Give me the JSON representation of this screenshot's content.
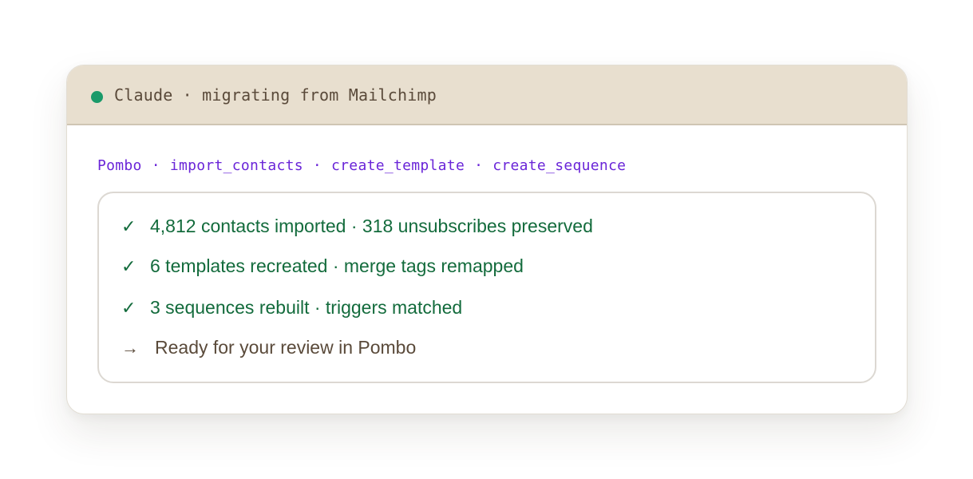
{
  "header": {
    "title": "Claude · migrating from Mailchimp",
    "status_color": "#1a9a6a"
  },
  "tools": [
    "Pombo",
    "import_contacts",
    "create_template",
    "create_sequence"
  ],
  "tool_separator": "·",
  "results": [
    {
      "icon": "check-icon",
      "text": "4,812 contacts imported · 318 unsubscribes preserved"
    },
    {
      "icon": "check-icon",
      "text": "6 templates recreated · merge tags remapped"
    },
    {
      "icon": "check-icon",
      "text": "3 sequences rebuilt · triggers matched"
    }
  ],
  "next_step": {
    "icon": "arrow-right-icon",
    "text": "Ready for your review in Pombo"
  },
  "colors": {
    "header_bg": "#e8dfcf",
    "tool_text": "#6a25d8",
    "success_text": "#136b3c",
    "muted_text": "#5a4a3a"
  }
}
